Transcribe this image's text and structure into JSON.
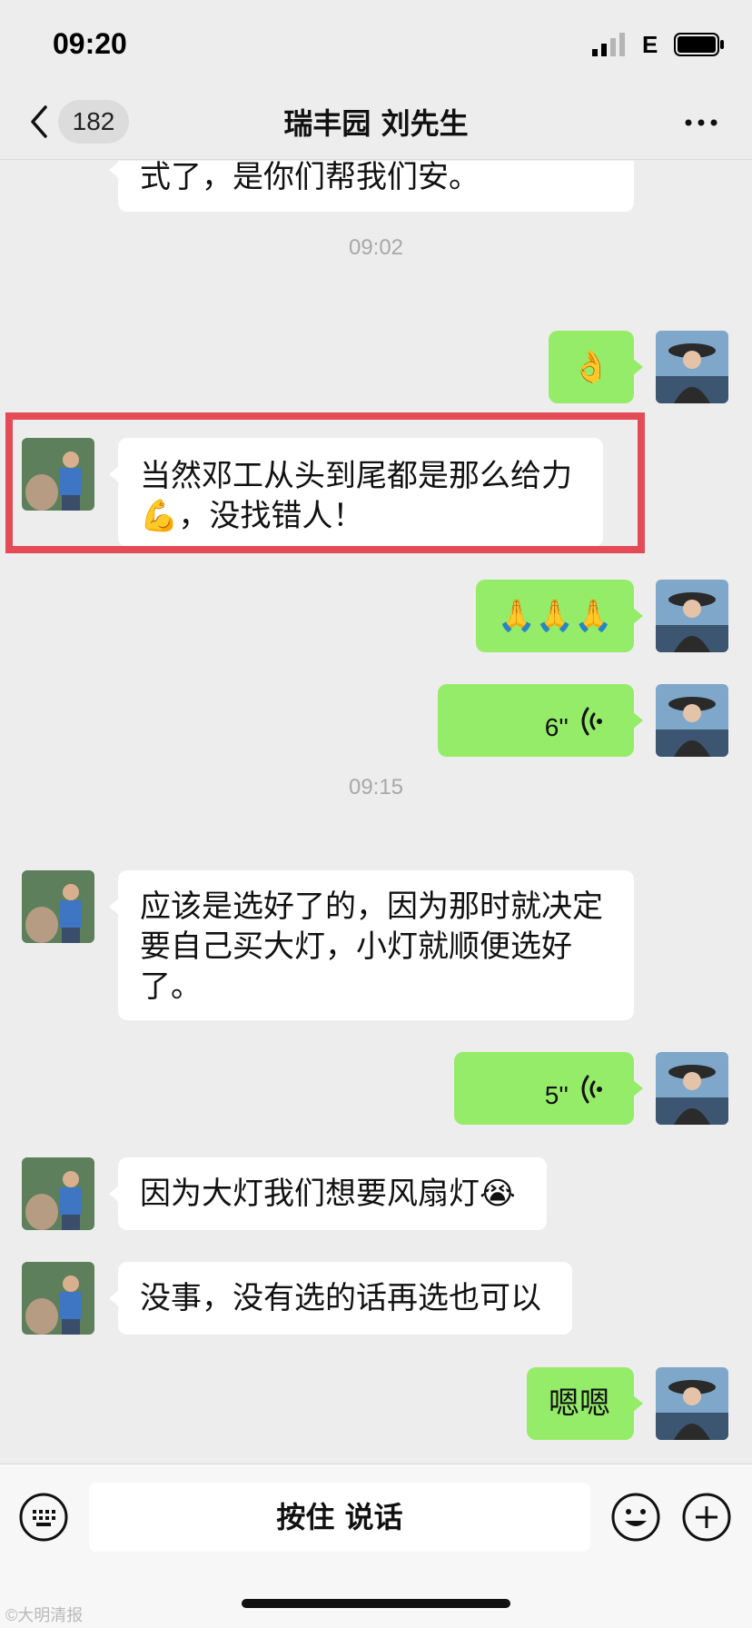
{
  "status_bar": {
    "time": "09:20",
    "network": "E"
  },
  "nav": {
    "unread_count": "182",
    "title": "瑞丰园 刘先生"
  },
  "messages": {
    "m1": "式了，是你们帮我们安。",
    "t1": "09:02",
    "m2": "👌",
    "m3": "当然邓工从头到尾都是那么给力💪，没找错人！",
    "m4": "🙏🙏🙏",
    "m5_duration": "6''",
    "t2": "09:15",
    "m6": "应该是选好了的，因为那时就决定要自己买大灯，小灯就顺便选好了。",
    "m7_duration": "5''",
    "m8": "因为大灯我们想要风扇灯😭",
    "m9": "没事，没有选的话再选也可以",
    "m10": "嗯嗯"
  },
  "input": {
    "talk_label": "按住 说话"
  },
  "watermark": "©大明清报",
  "colors": {
    "background": "#ededed",
    "outgoing_bubble": "#95ec69",
    "incoming_bubble": "#ffffff",
    "highlight": "#e44b57"
  },
  "icons": [
    "back-icon",
    "more-icon",
    "voice-icon",
    "keyboard-icon",
    "emoji-icon",
    "plus-icon",
    "signal-icon",
    "battery-icon"
  ]
}
